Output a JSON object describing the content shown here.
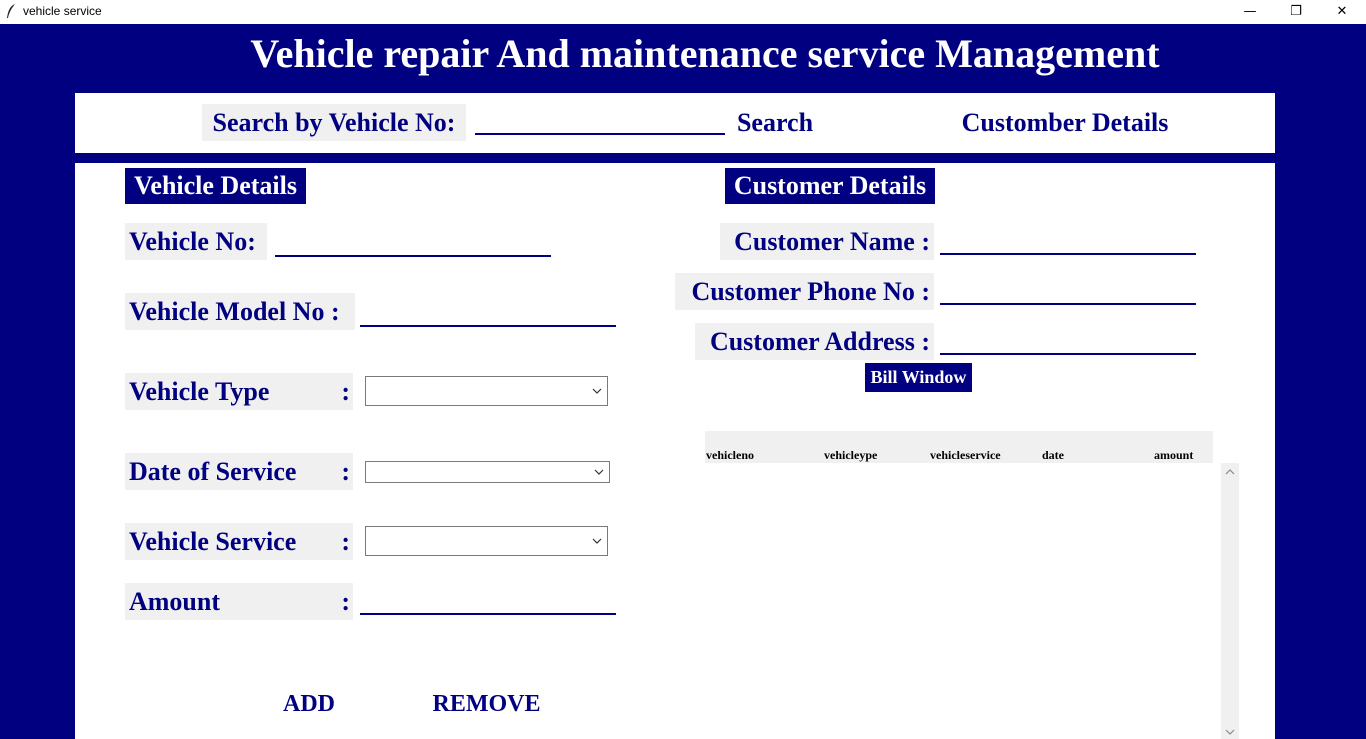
{
  "window": {
    "title": "vehicle service",
    "minimize": "—",
    "maximize": "❐",
    "close": "✕"
  },
  "header": {
    "title": "Vehicle repair And maintenance service Management"
  },
  "search": {
    "label": "Search by Vehicle No:",
    "value": "",
    "search_button": "Search",
    "customer_details_button": "Customber Details"
  },
  "vehicle": {
    "heading": "Vehicle Details",
    "vehicle_no_label": "Vehicle No:",
    "vehicle_no_value": "",
    "model_label": "Vehicle Model No :",
    "model_value": "",
    "type_label": "Vehicle Type",
    "type_value": "",
    "date_label": "Date of Service",
    "date_value": "",
    "service_label": "Vehicle Service",
    "service_value": "",
    "amount_label": "Amount",
    "amount_value": "",
    "colon": ":"
  },
  "customer": {
    "heading": "Customer Details",
    "name_label": "Customer Name :",
    "name_value": "",
    "phone_label": "Customer Phone No :",
    "phone_value": "",
    "address_label": "Customer Address :",
    "address_value": ""
  },
  "bill": {
    "button": "Bill Window",
    "columns": [
      "vehicleno",
      "vehicleype",
      "vehicleservice",
      "date",
      "amount"
    ],
    "rows": []
  },
  "actions": {
    "add": "ADD",
    "remove": "REMOVE"
  },
  "colors": {
    "navy": "#000080",
    "label_bg": "#f0f0f0",
    "white": "#ffffff"
  },
  "icons": {
    "app": "feather-icon",
    "dropdown": "chevron-down-icon",
    "scroll_up": "chevron-up-icon",
    "scroll_down": "chevron-down-icon"
  }
}
